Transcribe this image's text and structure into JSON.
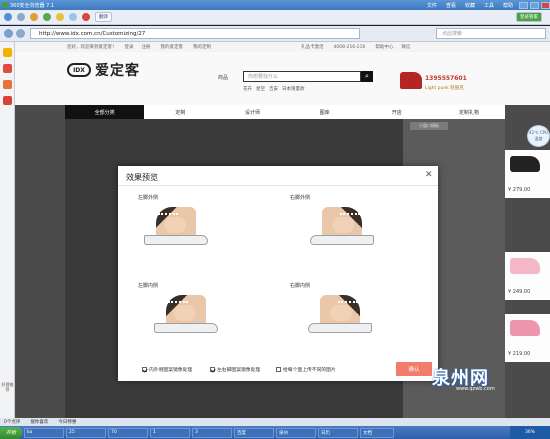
{
  "browser": {
    "title": "360安全浏览器 7.1",
    "menus": [
      "文件",
      "查看",
      "收藏",
      "工具",
      "帮助"
    ],
    "url": "http://www.idx.com.cn/Customizing/27",
    "search_placeholder": "点此搜索",
    "search_button": "搜索",
    "toolbar_items": [
      "翻译"
    ],
    "login_label": "登录管家"
  },
  "site": {
    "topbar": [
      "您好，欢迎来到爱定客！",
      "登录",
      "注册",
      "我的爱定客",
      "我的定制",
      "礼品卡激活",
      "4008-216-216",
      "帮助中心",
      "微信"
    ],
    "logo_text": "IDX",
    "brand": "爱定客",
    "search_label": "商品",
    "search_placeholder": "你想要找什么",
    "search_tags": [
      "花卉",
      "星空",
      "吉安",
      "日本限量款"
    ],
    "promo_count": "1395557601",
    "promo_sub": "Light punk 轻朋克",
    "nav": [
      "全部分类",
      "定制",
      "设计师",
      "图库",
      "开店",
      "定制礼物"
    ],
    "panel_button": "小窗口模板",
    "products": [
      {
        "price": "¥ 279.00"
      },
      {
        "price": "¥ 249.00"
      },
      {
        "price": "¥ 219.00"
      }
    ],
    "ad_badge": "42℃ CPU温度"
  },
  "modal": {
    "title": "效果预览",
    "close": "✕",
    "labels": [
      "左脚外侧",
      "右脚外侧",
      "左脚内侧",
      "右脚内侧"
    ],
    "options": [
      {
        "label": "内外侧图案镜像处理",
        "checked": true
      },
      {
        "label": "左右脚图案镜像处理",
        "checked": true
      },
      {
        "label": "给每个面上传不同的图片",
        "checked": false
      }
    ],
    "confirm": "确认"
  },
  "sidebar": {
    "bottom_label": "好搜推荐"
  },
  "statusbar": [
    "0个点评",
    "搜你喜欢",
    "今日特惠"
  ],
  "taskbar": {
    "start": "开始",
    "tasks": [
      "ka",
      "25",
      "70",
      "1",
      "3",
      "百度",
      "泉州",
      "日历",
      "文档"
    ],
    "tray": "36%"
  },
  "watermark": {
    "text": "泉州网",
    "url": "www.qzwb.com"
  }
}
